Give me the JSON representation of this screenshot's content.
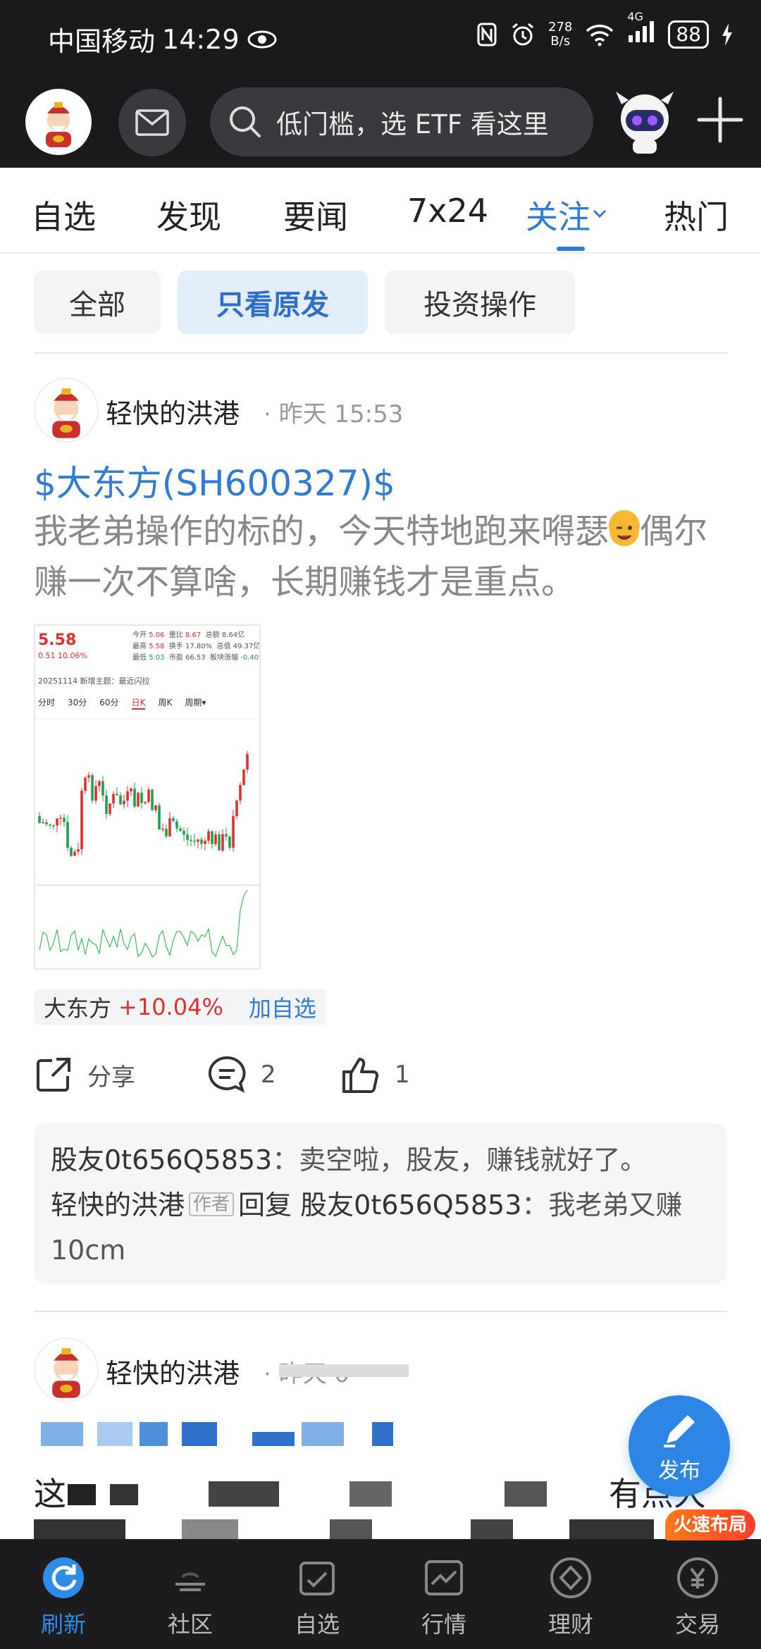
{
  "status_bar": {
    "carrier": "中国移动",
    "time": "14:29",
    "net_speed_value": "278",
    "net_speed_unit": "B/s",
    "network": "4G",
    "battery": "88"
  },
  "header": {
    "search_placeholder": "低门槛，选 ETF 看这里"
  },
  "tabs": [
    {
      "label": "自选"
    },
    {
      "label": "发现"
    },
    {
      "label": "要闻"
    },
    {
      "label": "7x24"
    },
    {
      "label": "关注",
      "active": true
    },
    {
      "label": "热门"
    }
  ],
  "filters": [
    {
      "label": "全部"
    },
    {
      "label": "只看原发",
      "active": true
    },
    {
      "label": "投资操作"
    }
  ],
  "post1": {
    "author": "轻快的洪港",
    "time": "· 昨天 15:53",
    "stock_link": "$大东方(SH600327)$",
    "text_part1": "我老弟操作的标的，今天特地跑来嘚瑟",
    "text_part2": "偶尔赚一次不算啥，长期赚钱才是重点。",
    "chart_thumb": {
      "price": "5.58",
      "change": "0.51 10.06%",
      "open_label": "今开",
      "open": "5.06",
      "high_label": "最高",
      "high": "5.58",
      "low_label": "最低",
      "low": "5.03",
      "vol_ratio_label": "量比",
      "vol_ratio": "8.67",
      "turnover_label": "换手",
      "turnover": "17.80%",
      "pe_label": "市盈",
      "pe": "66.53",
      "total_label": "总额",
      "total": "8.64亿",
      "mktcap_label": "总值",
      "mktcap": "49.37亿",
      "other_label": "板块涨幅",
      "other": "-0.40%",
      "theme": "20251114 新增主题：最近闪拉",
      "periods": [
        "分时",
        "30分",
        "60分",
        "日K",
        "周K",
        "周期▾"
      ]
    },
    "stock_tag": {
      "name": "大东方",
      "change": "+10.04%",
      "add": "加自选"
    },
    "actions": {
      "share": "分享",
      "comments": "2",
      "likes": "1"
    },
    "comments": [
      {
        "user": "股友0t656Q5853",
        "text": "：卖空啦，股友，赚钱就好了。"
      },
      {
        "user": "轻快的洪港",
        "badge": "作者",
        "reply_word": "回复",
        "target": "股友0t656Q5853",
        "text": "：我老弟又赚10cm"
      }
    ]
  },
  "post2": {
    "author": "轻快的洪港",
    "time": "· 昨天 0"
  },
  "fab": {
    "label": "发布"
  },
  "hot_badge": "火速布局",
  "bottom_nav": [
    {
      "label": "刷新",
      "active": true
    },
    {
      "label": "社区"
    },
    {
      "label": "自选"
    },
    {
      "label": "行情"
    },
    {
      "label": "理财"
    },
    {
      "label": "交易"
    }
  ],
  "colors": {
    "accent": "#2f7bd6",
    "up_red": "#e03030",
    "dark_bar": "#1a1a1c"
  }
}
